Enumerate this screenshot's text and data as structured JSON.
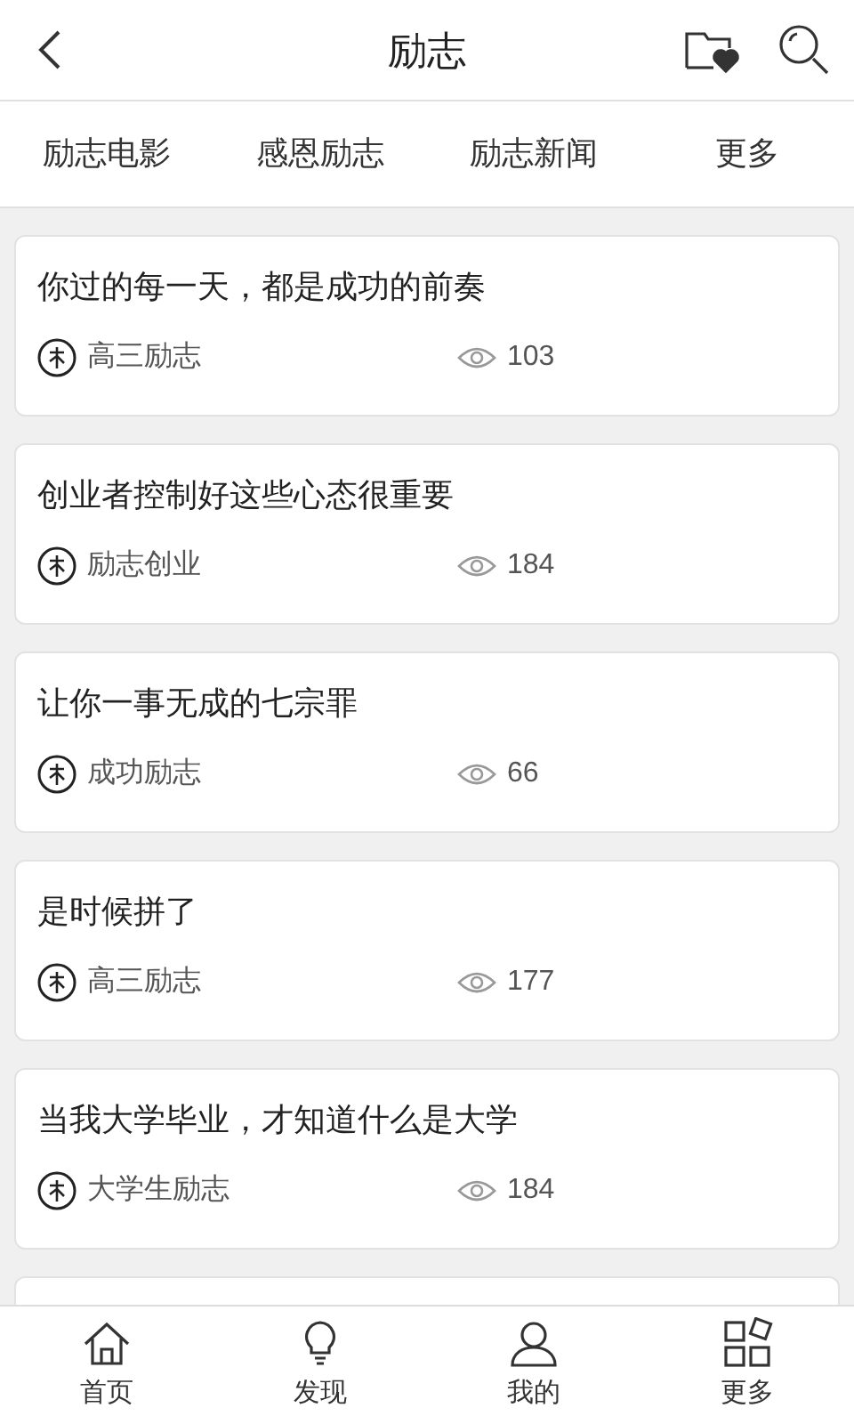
{
  "header": {
    "title": "励志"
  },
  "tabs": [
    "励志电影",
    "感恩励志",
    "励志新闻",
    "更多"
  ],
  "articles": [
    {
      "title": "你过的每一天，都是成功的前奏",
      "category": "高三励志",
      "views": "103"
    },
    {
      "title": "创业者控制好这些心态很重要",
      "category": "励志创业",
      "views": "184"
    },
    {
      "title": "让你一事无成的七宗罪",
      "category": "成功励志",
      "views": "66"
    },
    {
      "title": "是时候拼了",
      "category": "高三励志",
      "views": "177"
    },
    {
      "title": "当我大学毕业，才知道什么是大学",
      "category": "大学生励志",
      "views": "184"
    }
  ],
  "bottom_nav": [
    {
      "kind": "home",
      "label": "首页"
    },
    {
      "kind": "discover",
      "label": "发现"
    },
    {
      "kind": "profile",
      "label": "我的"
    },
    {
      "kind": "more",
      "label": "更多"
    }
  ]
}
